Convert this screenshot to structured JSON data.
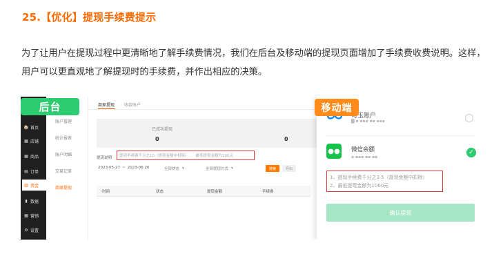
{
  "heading": "25.【优化】提现手续费提示",
  "paragraph": "为了让用户在提现过程中更清晰地了解手续费情况，我们在后台及移动端的提现页面增加了手续费收费说明。这样，用户可以更直观地了解提现时的手续费，并作出相应的决策。",
  "badges": {
    "admin": "后台",
    "mobile": "移动端"
  },
  "admin": {
    "sidebar": [
      {
        "icon": "🏠",
        "label": "首页"
      },
      {
        "icon": "▦",
        "label": "店铺"
      },
      {
        "icon": "▦",
        "label": "商品"
      },
      {
        "icon": "▤",
        "label": "订单"
      },
      {
        "icon": "▥",
        "label": "资金"
      },
      {
        "icon": "▮",
        "label": "数据"
      },
      {
        "icon": "▦",
        "label": "营销"
      },
      {
        "icon": "⚙",
        "label": "设置"
      }
    ],
    "subnav": [
      "账户管理",
      "统计报表",
      "账户明细",
      "交易记录",
      "商家提现"
    ],
    "tabs": [
      "商家提现",
      "收款账户"
    ],
    "stats": [
      {
        "label": "已成功提现",
        "value": "0"
      },
      {
        "label": "",
        "value": "0"
      }
    ],
    "notice_label": "提现说明",
    "notice_items": [
      "提现手续费千分之10（提现金额中扣除）",
      "最低提现金额为100元"
    ],
    "date_range": {
      "start": "2023-05-27",
      "sep": "~",
      "end": "2023-06-26"
    },
    "selects": [
      "全部状态",
      "全部提现方式"
    ],
    "search_label": "搜索",
    "export_label": "导出",
    "table_headers": [
      "时间",
      "状态",
      "提现金额",
      "手续费"
    ]
  },
  "mobile": {
    "account_name": "可玉账户",
    "account_meta": "▇ ▪ ▪▪▪ ▪▪ ▪▪▪",
    "wechat_label": "微信余额",
    "wechat_meta": "▪ ▪▪▪ ▪▪ ▪▪",
    "notice_items": [
      "1、提现手续费千分之3.5（提现金额中扣除）",
      "2、最低提现金额为1000元"
    ],
    "confirm_label": "确认提现"
  },
  "colors": {
    "accent": "#ff6a00",
    "highlight_border": "#e53935",
    "badge_admin": "#2ecc71",
    "badge_mobile": "#ff8c1a",
    "wechat_green": "#15c34b"
  }
}
